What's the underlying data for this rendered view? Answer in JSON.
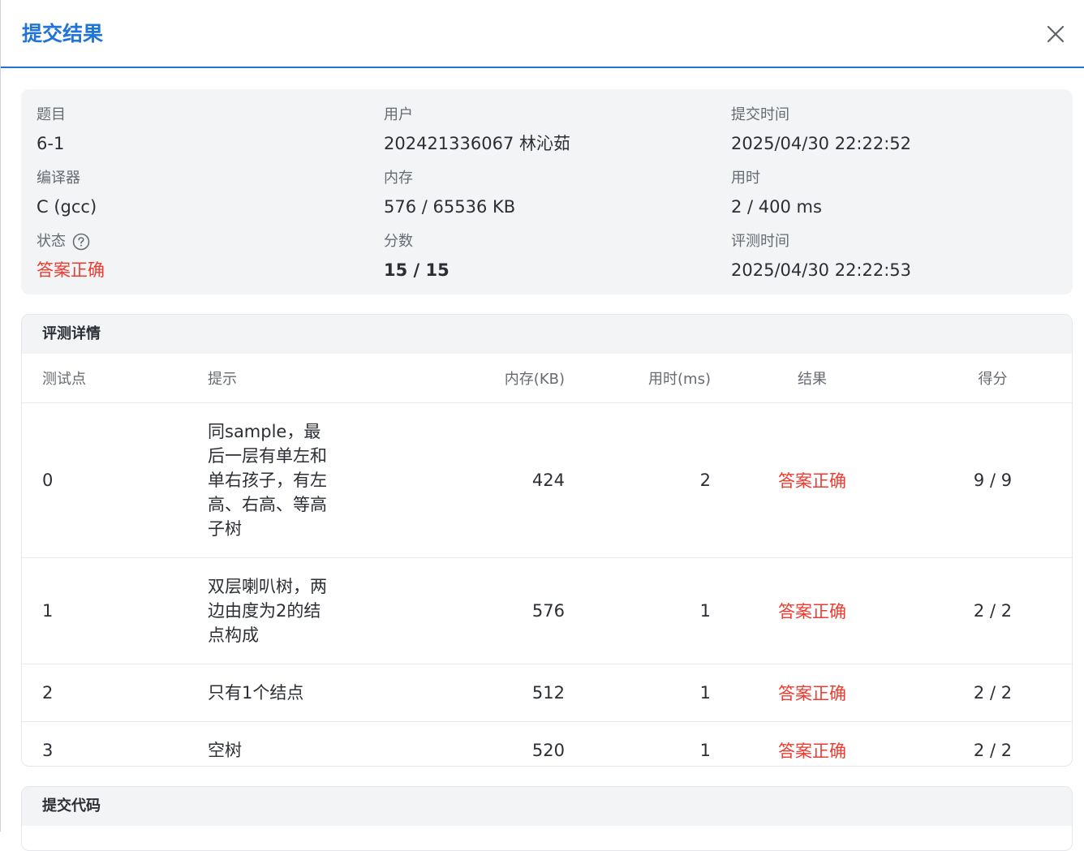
{
  "dialog": {
    "title": "提交结果",
    "close_icon": "close-icon"
  },
  "info": {
    "problem_label": "题目",
    "problem_value": "6-1",
    "user_label": "用户",
    "user_value": "202421336067 林沁茹",
    "submit_time_label": "提交时间",
    "submit_time_value": "2025/04/30 22:22:52",
    "compiler_label": "编译器",
    "compiler_value": "C (gcc)",
    "memory_label": "内存",
    "memory_value": "576 / 65536 KB",
    "time_label": "用时",
    "time_value": "2 / 400 ms",
    "status_label": "状态",
    "status_icon": "help-circle-icon",
    "status_value": "答案正确",
    "score_label": "分数",
    "score_value": "15 / 15",
    "judge_time_label": "评测时间",
    "judge_time_value": "2025/04/30 22:22:53"
  },
  "detail": {
    "title": "评测详情",
    "columns": [
      "测试点",
      "提示",
      "内存(KB)",
      "用时(ms)",
      "结果",
      "得分"
    ],
    "rows": [
      {
        "id": "0",
        "hint": "同sample，最后一层有单左和单右孩子，有左高、右高、等高子树",
        "memory": "424",
        "time": "2",
        "result": "答案正确",
        "score": "9 / 9"
      },
      {
        "id": "1",
        "hint": "双层喇叭树，两边由度为2的结点构成",
        "memory": "576",
        "time": "1",
        "result": "答案正确",
        "score": "2 / 2"
      },
      {
        "id": "2",
        "hint": "只有1个结点",
        "memory": "512",
        "time": "1",
        "result": "答案正确",
        "score": "2 / 2"
      },
      {
        "id": "3",
        "hint": "空树",
        "memory": "520",
        "time": "1",
        "result": "答案正确",
        "score": "2 / 2"
      }
    ]
  },
  "code": {
    "title": "提交代码"
  },
  "colors": {
    "accent": "#1f74d6",
    "success_text": "#ef3a2f"
  }
}
